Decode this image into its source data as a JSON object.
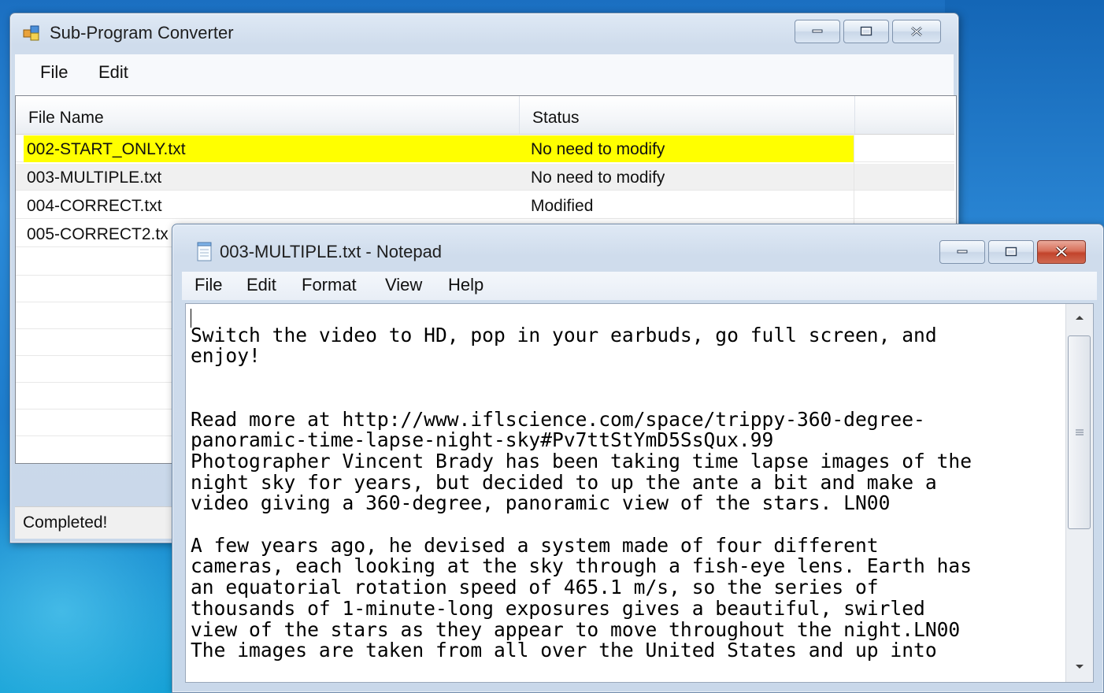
{
  "converter": {
    "title": "Sub-Program Converter",
    "menu": [
      "File",
      "Edit"
    ],
    "list": {
      "columns": [
        "File Name",
        "Status"
      ],
      "rows": [
        {
          "file": "002-START_ONLY.txt",
          "status": "No need to modify",
          "highlight": "#ffff00"
        },
        {
          "file": "003-MULTIPLE.txt",
          "status": "No need to modify"
        },
        {
          "file": "004-CORRECT.txt",
          "status": "Modified"
        },
        {
          "file": "005-CORRECT2.tx",
          "status": ""
        }
      ]
    },
    "status": "Completed!"
  },
  "notepad": {
    "title": "003-MULTIPLE.txt - Notepad",
    "menu": [
      "File",
      "Edit",
      "Format",
      "View",
      "Help"
    ],
    "text": "\nSwitch the video to HD, pop in your earbuds, go full screen, and\nenjoy!\n\n\nRead more at http://www.iflscience.com/space/trippy-360-degree-\npanoramic-time-lapse-night-sky#Pv7ttStYmD5SsQux.99\nPhotographer Vincent Brady has been taking time lapse images of the\nnight sky for years, but decided to up the ante a bit and make a\nvideo giving a 360-degree, panoramic view of the stars. LN00\n\nA few years ago, he devised a system made of four different\ncameras, each looking at the sky through a fish-eye lens. Earth has\nan equatorial rotation speed of 465.1 m/s, so the series of\nthousands of 1-minute-long exposures gives a beautiful, swirled\nview of the stars as they appear to move throughout the night.LN00\nThe images are taken from all over the United States and up into"
  },
  "icons": {
    "converter_app": "application-icon",
    "notepad_app": "notepad-icon",
    "minimize": "minimize-icon",
    "maximize": "maximize-icon",
    "close": "close-icon"
  }
}
